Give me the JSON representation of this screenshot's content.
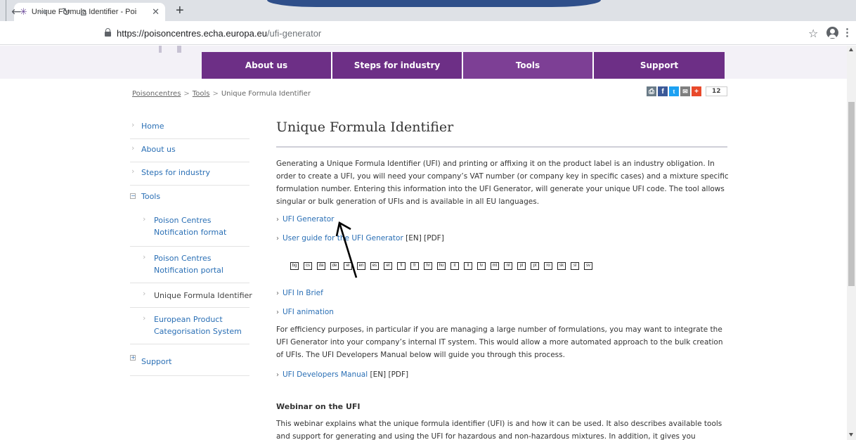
{
  "browser": {
    "tab_title": "Unique Formula Identifier - Poison C",
    "tab_close": "✕",
    "new_tab": "+",
    "url_host": "https://poisoncentres.echa.europa.eu",
    "url_path": "/ufi-generator"
  },
  "nav": {
    "items": [
      "About us",
      "Steps for industry",
      "Tools",
      "Support"
    ]
  },
  "breadcrumb": {
    "items": [
      "Poisoncentres",
      "Tools",
      "Unique Formula Identifier"
    ],
    "separator": ">"
  },
  "share": {
    "count": "12",
    "colors": [
      "#6a7b87",
      "#3b5998",
      "#1da1f2",
      "#7f7f7f",
      "#e8492b"
    ]
  },
  "sidebar": {
    "items": [
      {
        "label": "Home"
      },
      {
        "label": "About us"
      },
      {
        "label": "Steps for industry"
      },
      {
        "label": "Tools",
        "expander": "−"
      },
      {
        "label": "Support",
        "expander": "+"
      }
    ],
    "sub_items": [
      {
        "line1": "Poison Centres",
        "line2": "Notification format"
      },
      {
        "line1": "Poison Centres",
        "line2": "Notification portal"
      },
      {
        "line1": "Unique Formula Identifier"
      },
      {
        "line1": "European Product",
        "line2": "Categorisation System"
      }
    ]
  },
  "main": {
    "title": "Unique Formula Identifier",
    "intro": "Generating a Unique Formula Identifier (UFI) and printing or affixing it on the product label is an industry obligation. In order to create a UFI, you will need your company’s VAT number (or company key in specific cases) and a mixture specific formulation number. Entering this information into the UFI Generator, will generate your unique UFI code. The tool allows singular or bulk generation of UFIs and is available in all EU languages.",
    "link_ufi_generator": "UFI Generator",
    "link_user_guide": "User guide for the UFI Generator",
    "user_guide_suffix": "[EN] [PDF]",
    "languages": [
      "bg",
      "cs",
      "da",
      "de",
      "el",
      "en",
      "es",
      "et",
      "fi",
      "fr",
      "hr",
      "hu",
      "it",
      "lt",
      "lv",
      "mt",
      "nl",
      "pl",
      "pt",
      "ro",
      "sk",
      "sl",
      "sv"
    ],
    "link_in_brief": "UFI In Brief",
    "link_animation": "UFI animation",
    "efficiency": "For efficiency purposes, in particular if you are managing a large number of formulations, you may want to integrate the UFI Generator into your company’s internal IT system. This would allow a more automated approach to the bulk creation of UFIs. The UFI Developers Manual below will guide you through this process.",
    "link_dev_manual": "UFI Developers Manual",
    "dev_manual_suffix": "[EN] [PDF]",
    "webinar_title": "Webinar on the UFI",
    "webinar_text": "This webinar explains what the unique formula identifier (UFI) is and how it can be used. It also describes available tools and support for generating and using the UFI for hazardous and non-hazardous mixtures. In addition, it gives you"
  },
  "colors": {
    "nav_purple": "#6d2f86",
    "link_blue": "#2a6fb5"
  }
}
